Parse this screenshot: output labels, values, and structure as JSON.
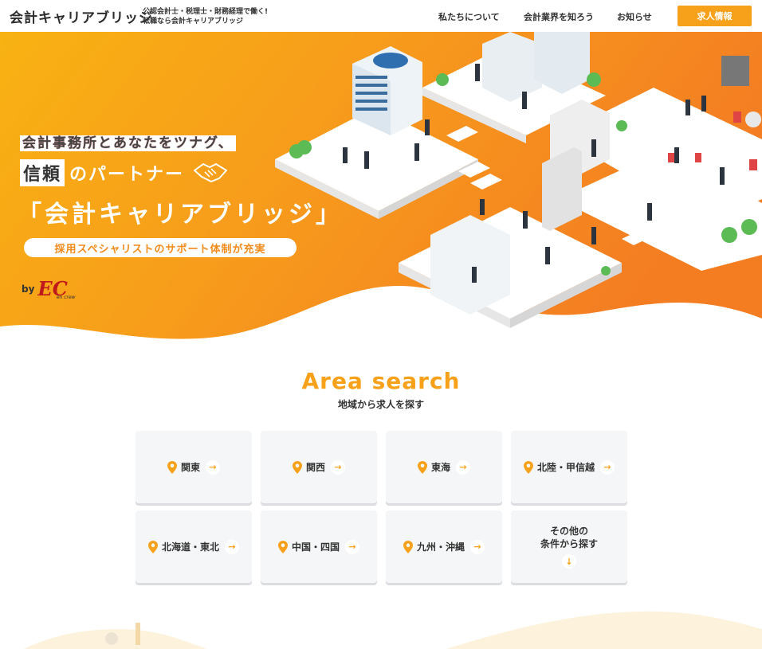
{
  "header": {
    "logo": "会計キャリアブリッジ",
    "tagline_1": "公認会計士・税理士・財務経理で働く!",
    "tagline_2": "転職なら会計キャリアブリッジ",
    "nav": [
      {
        "label": "私たちについて"
      },
      {
        "label": "会計業界を知ろう"
      },
      {
        "label": "お知らせ"
      }
    ],
    "cta": "求人情報"
  },
  "hero": {
    "line1": "会計事務所とあなたをツナグ、",
    "line2_box": "信頼",
    "line2_rest": "のパートナー",
    "line3": "「会計キャリアブリッジ」",
    "pill": "採用スペシャリストのサポート体制が充実",
    "by": "by",
    "brand": "EC",
    "brand_sub": "en crew"
  },
  "area": {
    "title": "Area search",
    "subtitle": "地域から求人を探す",
    "cards": [
      {
        "label": "関東",
        "icon": "pin-icon",
        "arrow": "→"
      },
      {
        "label": "関西",
        "icon": "pin-icon",
        "arrow": "→"
      },
      {
        "label": "東海",
        "icon": "pin-icon",
        "arrow": "→"
      },
      {
        "label": "北陸・甲信越",
        "icon": "pin-icon",
        "arrow": "→"
      },
      {
        "label": "北海道・東北",
        "icon": "pin-icon",
        "arrow": "→"
      },
      {
        "label": "中国・四国",
        "icon": "pin-icon",
        "arrow": "→"
      },
      {
        "label": "九州・沖縄",
        "icon": "pin-icon",
        "arrow": "→"
      }
    ],
    "other": {
      "label": "その他の\n条件から探す",
      "arrow": "↓"
    }
  },
  "colors": {
    "accent": "#f7a11a",
    "hero_orange": "#f58a1f",
    "card_bg": "#f5f6f7"
  }
}
